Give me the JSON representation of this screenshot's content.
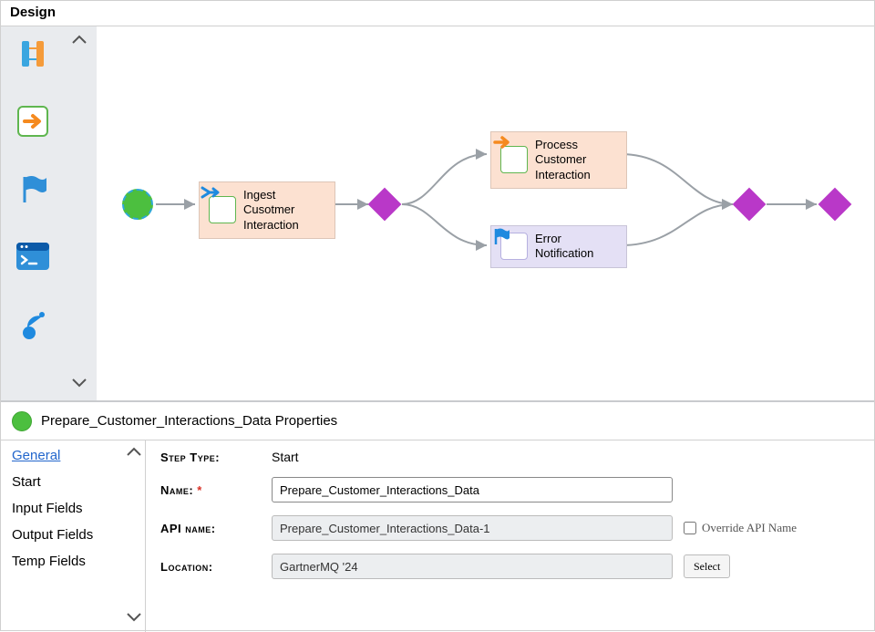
{
  "title": "Design",
  "palette": {
    "items": [
      "parallel-icon",
      "forward-icon",
      "flag-icon",
      "terminal-icon",
      "satellite-icon"
    ]
  },
  "canvas": {
    "start": {
      "type": "start"
    },
    "nodes": [
      {
        "id": "ingest",
        "label": "Ingest Cusotmer Interaction",
        "icon": "merge-arrow-icon"
      },
      {
        "id": "process",
        "label": "Process Customer Interaction",
        "icon": "forward-arrow-icon"
      },
      {
        "id": "error",
        "label": "Error Notification",
        "icon": "flag-icon"
      }
    ]
  },
  "properties": {
    "header": "Prepare_Customer_Interactions_Data Properties",
    "tabs": [
      "General",
      "Start",
      "Input Fields",
      "Output Fields",
      "Temp Fields"
    ],
    "active_tab": 0,
    "form": {
      "step_type_label": "Step Type:",
      "step_type_value": "Start",
      "name_label": "Name:",
      "name_value": "Prepare_Customer_Interactions_Data",
      "api_label": "API name:",
      "api_value": "Prepare_Customer_Interactions_Data-1",
      "override_label": "Override API Name",
      "location_label": "Location:",
      "location_value": "GartnerMQ '24",
      "select_label": "Select"
    }
  }
}
